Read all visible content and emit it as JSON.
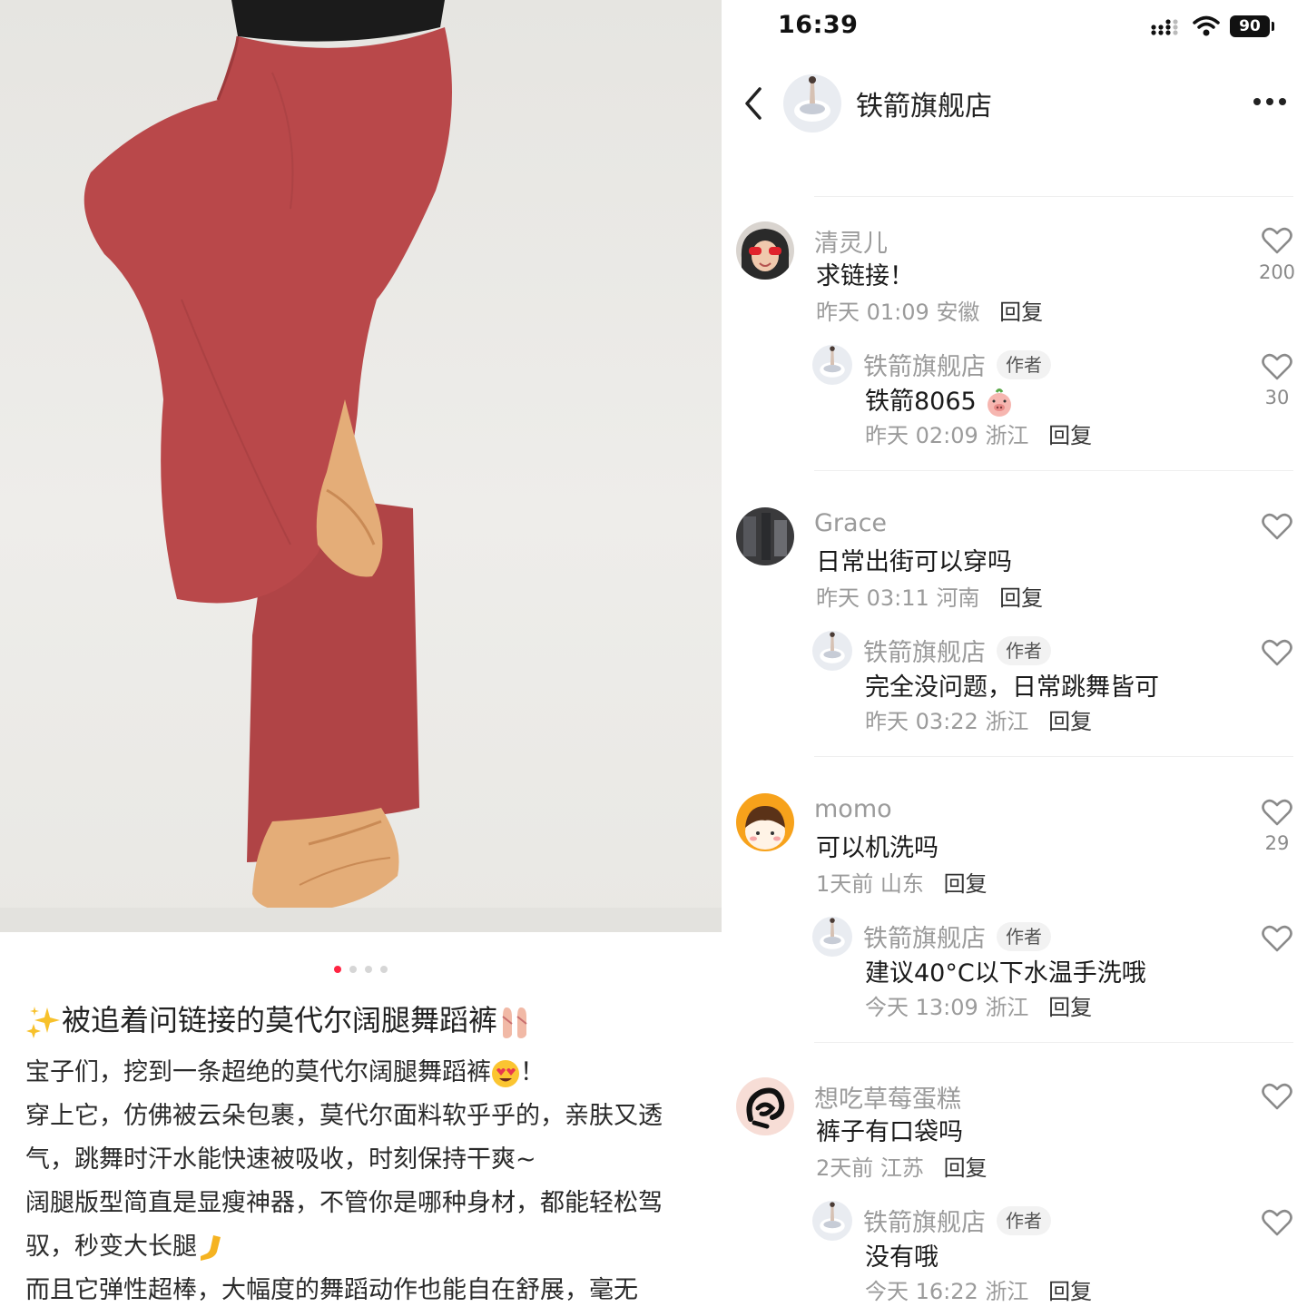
{
  "post": {
    "carousel_dots": 4,
    "active_dot": 0,
    "title": "被追着问链接的莫代尔阔腿舞蹈裤",
    "title_prefix_icon": "sparkles-icon",
    "title_suffix_icon": "ballet-shoes-icon",
    "body": [
      "宝子们，挖到一条超绝的莫代尔阔腿舞蹈裤",
      "！",
      "穿上它，仿佛被云朵包裹，莫代尔面料软乎乎的，亲肤又透气，跳舞时汗水能快速被吸收，时刻保持干爽~",
      "阔腿版型简直是显瘦神器，不管你是哪种身材，都能轻松驾驭，秒变大长腿",
      "而且它弹性超棒，大幅度的舞蹈动作也能自在舒展，毫无"
    ],
    "accent_color": "#ff2442",
    "pants_color": "#b9484a"
  },
  "status": {
    "time": "16:39",
    "battery": "90"
  },
  "header": {
    "shop_name": "铁箭旗舰店"
  },
  "comments": [
    {
      "user": "清灵儿",
      "text": "求链接！",
      "time": "昨天 01:09",
      "region": "安徽",
      "reply_label": "回复",
      "likes": "200",
      "reply": {
        "user": "铁箭旗舰店",
        "tag": "作者",
        "text": "铁箭8065",
        "time": "昨天 02:09",
        "region": "浙江",
        "reply_label": "回复",
        "likes": "30"
      }
    },
    {
      "user": "Grace",
      "text": "日常出街可以穿吗",
      "time": "昨天 03:11",
      "region": "河南",
      "reply_label": "回复",
      "likes": "",
      "reply": {
        "user": "铁箭旗舰店",
        "tag": "作者",
        "text": "完全没问题，日常跳舞皆可",
        "time": "昨天 03:22",
        "region": "浙江",
        "reply_label": "回复",
        "likes": ""
      }
    },
    {
      "user": "momo",
      "text": "可以机洗吗",
      "time": "1天前",
      "region": "山东",
      "reply_label": "回复",
      "likes": "29",
      "reply": {
        "user": "铁箭旗舰店",
        "tag": "作者",
        "text": "建议40°C以下水温手洗哦",
        "time": "今天 13:09",
        "region": "浙江",
        "reply_label": "回复",
        "likes": ""
      }
    },
    {
      "user": "想吃草莓蛋糕",
      "text": "裤子有口袋吗",
      "time": "2天前",
      "region": "江苏",
      "reply_label": "回复",
      "likes": "",
      "reply": {
        "user": "铁箭旗舰店",
        "tag": "作者",
        "text": "没有哦",
        "time": "今天 16:22",
        "region": "浙江",
        "reply_label": "回复",
        "likes": ""
      }
    }
  ]
}
